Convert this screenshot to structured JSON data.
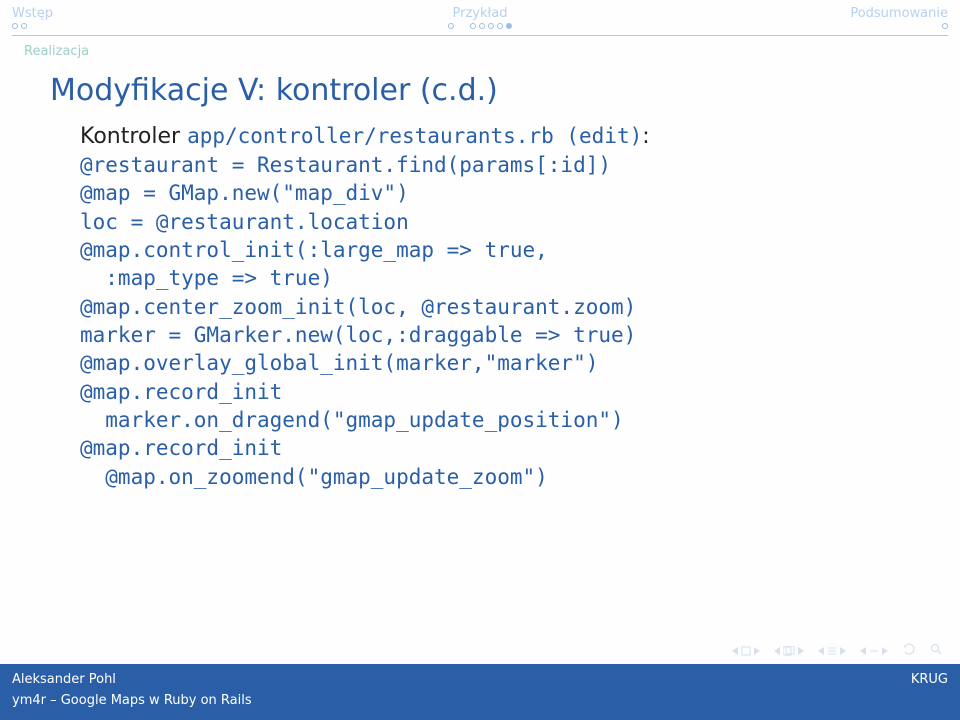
{
  "nav": {
    "sections": {
      "left": "Wstęp",
      "center": "Przykład",
      "right": "Podsumowanie"
    },
    "subsection": "Realizacja"
  },
  "slide": {
    "title": "Modyfikacje V: kontroler (c.d.)",
    "intro_prefix": "Kontroler ",
    "intro_code": "app/controller/restaurants.rb (edit)",
    "intro_suffix": ":",
    "code": "@restaurant = Restaurant.find(params[:id])\n@map = GMap.new(\"map_div\")\nloc = @restaurant.location\n@map.control_init(:large_map => true,\n  :map_type => true)\n@map.center_zoom_init(loc, @restaurant.zoom)\nmarker = GMarker.new(loc,:draggable => true)\n@map.overlay_global_init(marker,\"marker\")\n@map.record_init\n  marker.on_dragend(\"gmap_update_position\")\n@map.record_init\n  @map.on_zoomend(\"gmap_update_zoom\")"
  },
  "footer": {
    "author": "Aleksander Pohl",
    "org": "KRUG",
    "talk": "ym4r – Google Maps w Ruby on Rails"
  }
}
